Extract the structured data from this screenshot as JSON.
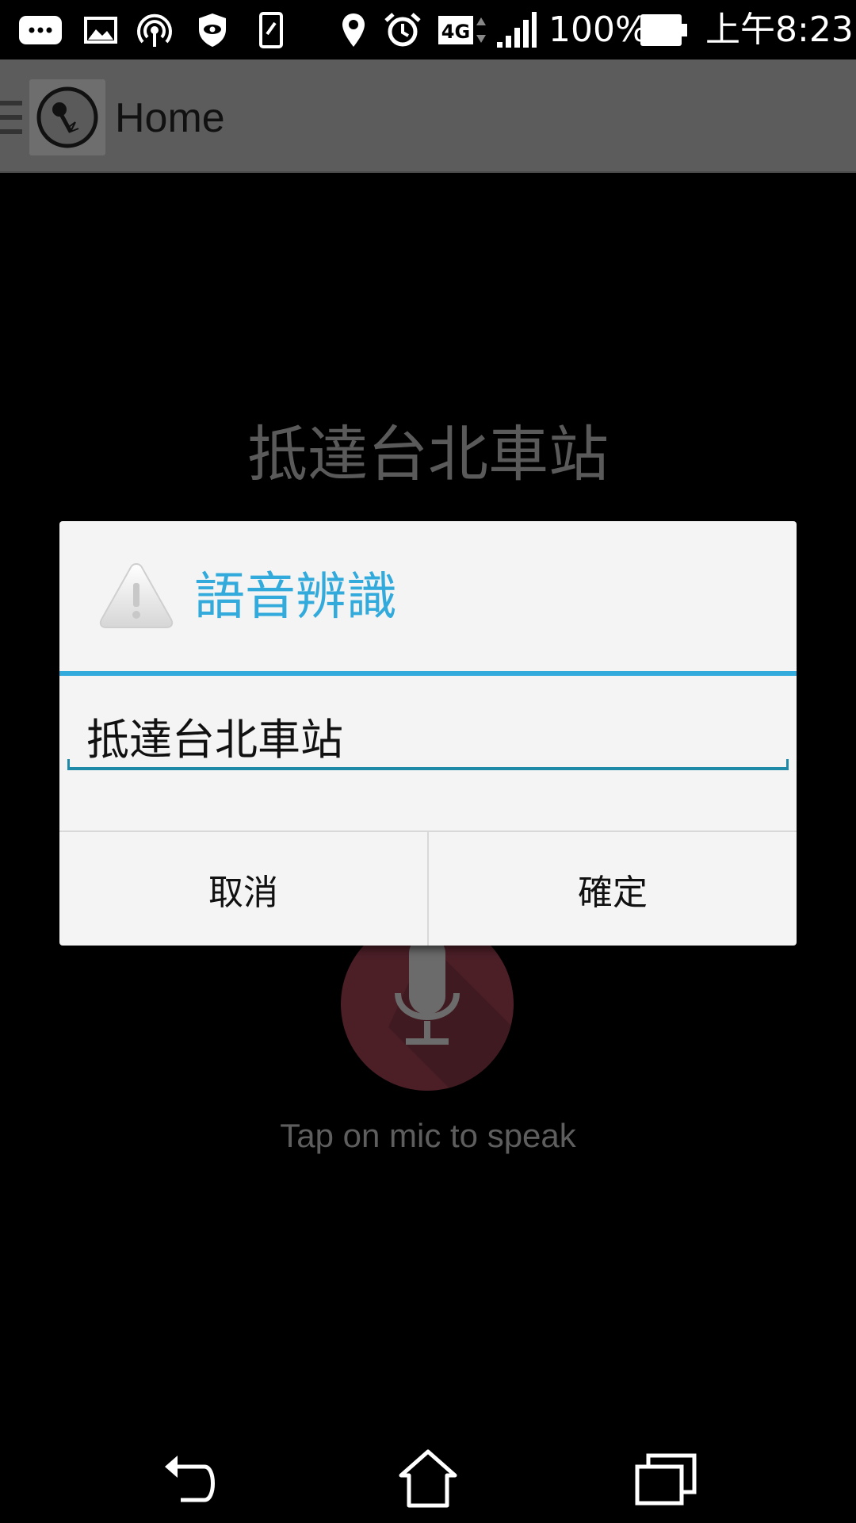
{
  "status_bar": {
    "battery_text": "100%",
    "time": "上午8:23",
    "network_badge": "4G",
    "icons": [
      "messages-icon",
      "gallery-icon",
      "hotspot-icon",
      "shield-icon",
      "phone-icon",
      "location-icon",
      "alarm-icon",
      "network-4g-icon",
      "signal-icon",
      "battery-icon"
    ]
  },
  "app_bar": {
    "title": "Home",
    "icons": [
      "drawer-menu-icon",
      "app-logo-icon"
    ]
  },
  "main": {
    "recognized_text": "抵達台北車站",
    "mic_hint": "Tap on mic to speak",
    "mic_icon": "microphone-icon"
  },
  "dialog": {
    "title": "語音辨識",
    "icon": "warning-icon",
    "input_value": "抵達台北車站",
    "cancel_label": "取消",
    "confirm_label": "確定"
  },
  "nav_bar": {
    "icons": [
      "back-icon",
      "home-icon",
      "recents-icon"
    ]
  },
  "colors": {
    "accent": "#33aadc",
    "app_bar": "#5c5c5c",
    "dialog_bg": "#f4f4f4",
    "mic_button": "#4c1f27"
  }
}
